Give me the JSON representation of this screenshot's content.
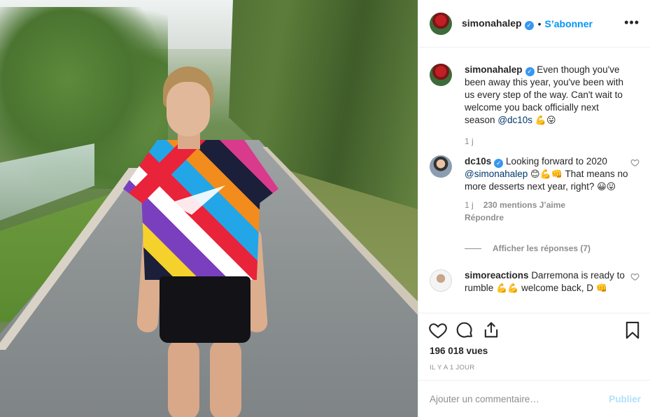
{
  "post": {
    "username": "simonahalep",
    "follow_label": "S’abonner",
    "separator": "•",
    "more_label": "•••"
  },
  "comments": [
    {
      "username": "simonahalep",
      "text": "Even though you've been away this year, you've been with us every step of the way. Can't wait to welcome you back officially next season",
      "mention": "@dc10s",
      "emojis": "💪😛",
      "age": "1 j"
    },
    {
      "username": "dc10s",
      "text_before": "Looking forward to 2020",
      "mention": "@simonahalep",
      "emojis_1": "😊💪👊",
      "text_after": "That means no more desserts next year, right?",
      "emojis_2": "😀😛",
      "age": "1 j",
      "likes": "230 mentions J’aime",
      "reply_label": "Répondre",
      "view_replies": "Afficher les réponses (7)"
    },
    {
      "username": "simoreactions",
      "text_before": "Darremona is ready to rumble",
      "emojis_1": "💪💪",
      "text_after": "welcome back, D",
      "emojis_2": "👊"
    }
  ],
  "stats": {
    "views": "196 018 vues",
    "time_ago": "IL Y A 1 JOUR"
  },
  "comment_box": {
    "placeholder": "Ajouter un commentaire…",
    "publish_label": "Publier"
  },
  "icons": {
    "like": "heart-icon",
    "comment": "comment-icon",
    "share": "share-icon",
    "save": "bookmark-icon",
    "verified": "verified-badge-icon",
    "comment_like": "heart-outline-icon"
  },
  "colors": {
    "accent": "#0095f6",
    "verified": "#3897f0",
    "muted": "#8e8e8e",
    "publish_disabled": "#b2dffc"
  }
}
